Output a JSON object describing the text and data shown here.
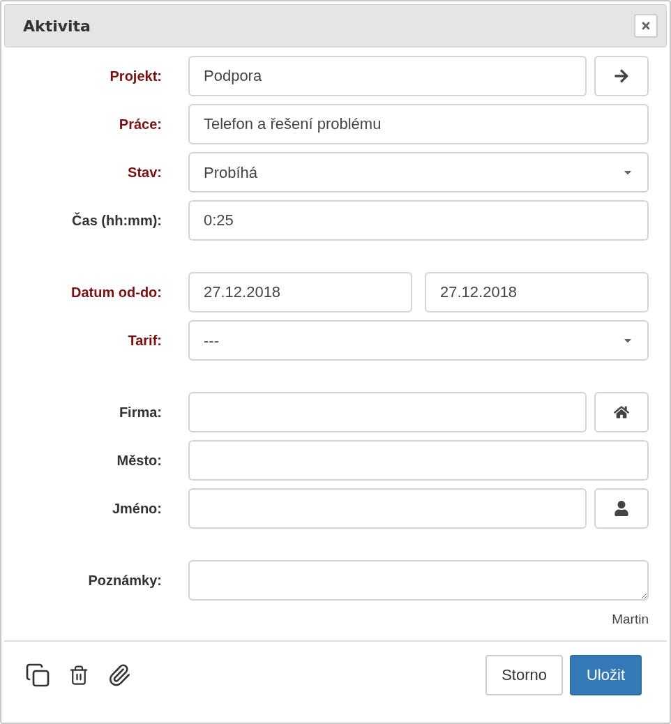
{
  "dialog": {
    "title": "Aktivita"
  },
  "sections": [
    [
      {
        "label": "Projekt:",
        "required": true,
        "kind": "text_button",
        "value": "Podpora",
        "button": {
          "kind": "arrow"
        }
      },
      {
        "label": "Práce:",
        "required": true,
        "kind": "text",
        "value": "Telefon a řešení problému"
      },
      {
        "label": "Stav:",
        "required": true,
        "kind": "select",
        "value": "Probíhá"
      },
      {
        "label": "Čas (hh:mm):",
        "required": false,
        "kind": "text",
        "value": "0:25"
      }
    ],
    [
      {
        "label": "Datum od-do:",
        "required": true,
        "kind": "date_range",
        "from": "27.12.2018",
        "to": "27.12.2018"
      },
      {
        "label": "Tarif:",
        "required": true,
        "kind": "select",
        "value": "---"
      }
    ],
    [
      {
        "label": "Firma:",
        "required": false,
        "kind": "text_button",
        "button": {
          "kind": "home"
        }
      },
      {
        "label": "Město:",
        "required": false,
        "kind": "text"
      },
      {
        "label": "Jméno:",
        "required": false,
        "kind": "text_button",
        "button": {
          "kind": "person"
        }
      }
    ],
    [
      {
        "label": "Poznámky:",
        "required": false,
        "kind": "textarea"
      }
    ]
  ],
  "author": "Martin",
  "footer": {
    "cancel": "Storno",
    "save": "Uložit"
  }
}
